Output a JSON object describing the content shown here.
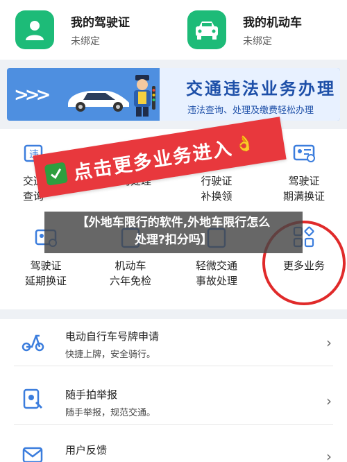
{
  "top_cards": [
    {
      "title": "我的驾驶证",
      "status": "未绑定",
      "icon": "driver-license-person-icon"
    },
    {
      "title": "我的机动车",
      "status": "未绑定",
      "icon": "car-front-icon"
    }
  ],
  "banner": {
    "title": "交通违法业务办理",
    "subtitle": "违法查询、处理及缴费轻松办理"
  },
  "grid": {
    "items": [
      {
        "line1": "交通",
        "line2": "查询",
        "icon": "violation-icon"
      },
      {
        "line1": "",
        "line2": "预约处理",
        "icon": "calendar-icon"
      },
      {
        "line1": "行驶证",
        "line2": "补换领",
        "icon": "vehicle-license-icon"
      },
      {
        "line1": "驾驶证",
        "line2": "期满换证",
        "icon": "license-renew-icon"
      },
      {
        "line1": "驾驶证",
        "line2": "延期换证",
        "icon": "license-extend-icon"
      },
      {
        "line1": "机动车",
        "line2": "六年免检",
        "icon": "inspection-icon"
      },
      {
        "line1": "轻微交通",
        "line2": "事故处理",
        "icon": "accident-icon"
      },
      {
        "line1": "更多业务",
        "line2": "",
        "icon": "more-grid-icon"
      }
    ]
  },
  "annotation": {
    "sticker_text": "点击更多业务进入",
    "sticker_emoji": "👌"
  },
  "overlay": {
    "line1": "【外地车限行的软件,外地车限行怎么",
    "line2": "处理?扣分吗】"
  },
  "list": {
    "items": [
      {
        "title": "电动自行车号牌申请",
        "desc": "快捷上牌，安全骑行。",
        "icon": "scooter-icon"
      },
      {
        "title": "随手拍举报",
        "desc": "随手举报，规范交通。",
        "icon": "camera-report-icon"
      },
      {
        "title": "用户反馈",
        "desc": "",
        "icon": "feedback-mail-icon"
      }
    ],
    "chevron": "›"
  },
  "colors": {
    "green": "#1dbb78",
    "blue": "#1d4fa8",
    "red": "#e8383d"
  }
}
